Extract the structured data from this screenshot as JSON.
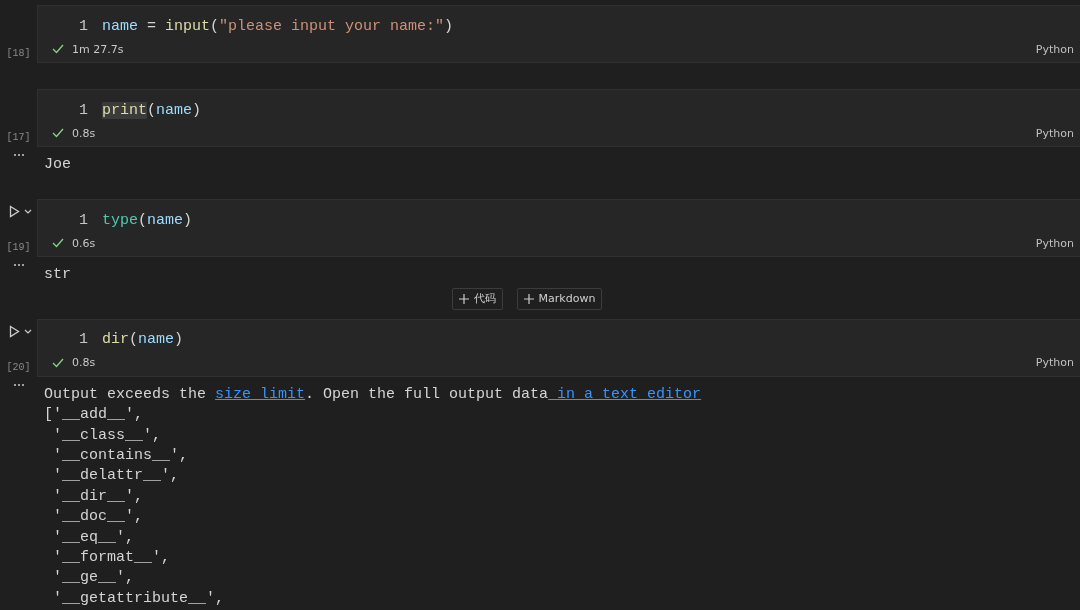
{
  "cells": [
    {
      "execution_count": "[18]",
      "run_controls": false,
      "line_number": "1",
      "code": [
        {
          "kind": "variable",
          "text": "name"
        },
        {
          "kind": "punct",
          "text": " = "
        },
        {
          "kind": "function",
          "text": "input"
        },
        {
          "kind": "punct",
          "text": "("
        },
        {
          "kind": "string",
          "text": "\"please input your name:\""
        },
        {
          "kind": "punct",
          "text": ")"
        }
      ],
      "succeeded": true,
      "time": "1m 27.7s",
      "language": "Python"
    },
    {
      "execution_count": "[17]",
      "run_controls": false,
      "line_number": "1",
      "code": [
        {
          "kind": "function",
          "text": "print",
          "highlighted": true
        },
        {
          "kind": "punct",
          "text": "("
        },
        {
          "kind": "variable",
          "text": "name"
        },
        {
          "kind": "punct",
          "text": ")"
        }
      ],
      "succeeded": true,
      "time": "0.8s",
      "language": "Python",
      "output": {
        "lines": [
          "Joe"
        ]
      }
    },
    {
      "execution_count": "[19]",
      "run_controls": true,
      "line_number": "1",
      "code": [
        {
          "kind": "class",
          "text": "type"
        },
        {
          "kind": "punct",
          "text": "("
        },
        {
          "kind": "variable",
          "text": "name"
        },
        {
          "kind": "punct",
          "text": ")"
        }
      ],
      "succeeded": true,
      "time": "0.6s",
      "language": "Python",
      "output": {
        "lines": [
          "str"
        ]
      },
      "insert_buttons": [
        "代码",
        "Markdown"
      ]
    },
    {
      "execution_count": "[20]",
      "run_controls": true,
      "line_number": "1",
      "code": [
        {
          "kind": "function",
          "text": "dir"
        },
        {
          "kind": "punct",
          "text": "("
        },
        {
          "kind": "variable",
          "text": "name"
        },
        {
          "kind": "punct",
          "text": ")"
        }
      ],
      "succeeded": true,
      "time": "0.8s",
      "language": "Python",
      "output": {
        "notice": [
          {
            "kind": "text",
            "text": "Output exceeds the "
          },
          {
            "kind": "link",
            "text": "size limit"
          },
          {
            "kind": "text",
            "text": ". Open the full output data"
          },
          {
            "kind": "link",
            "text": " in a text editor"
          }
        ],
        "lines": [
          "['__add__',",
          " '__class__',",
          " '__contains__',",
          " '__delattr__',",
          " '__dir__',",
          " '__doc__',",
          " '__eq__',",
          " '__format__',",
          " '__ge__',",
          " '__getattribute__',"
        ]
      }
    }
  ]
}
